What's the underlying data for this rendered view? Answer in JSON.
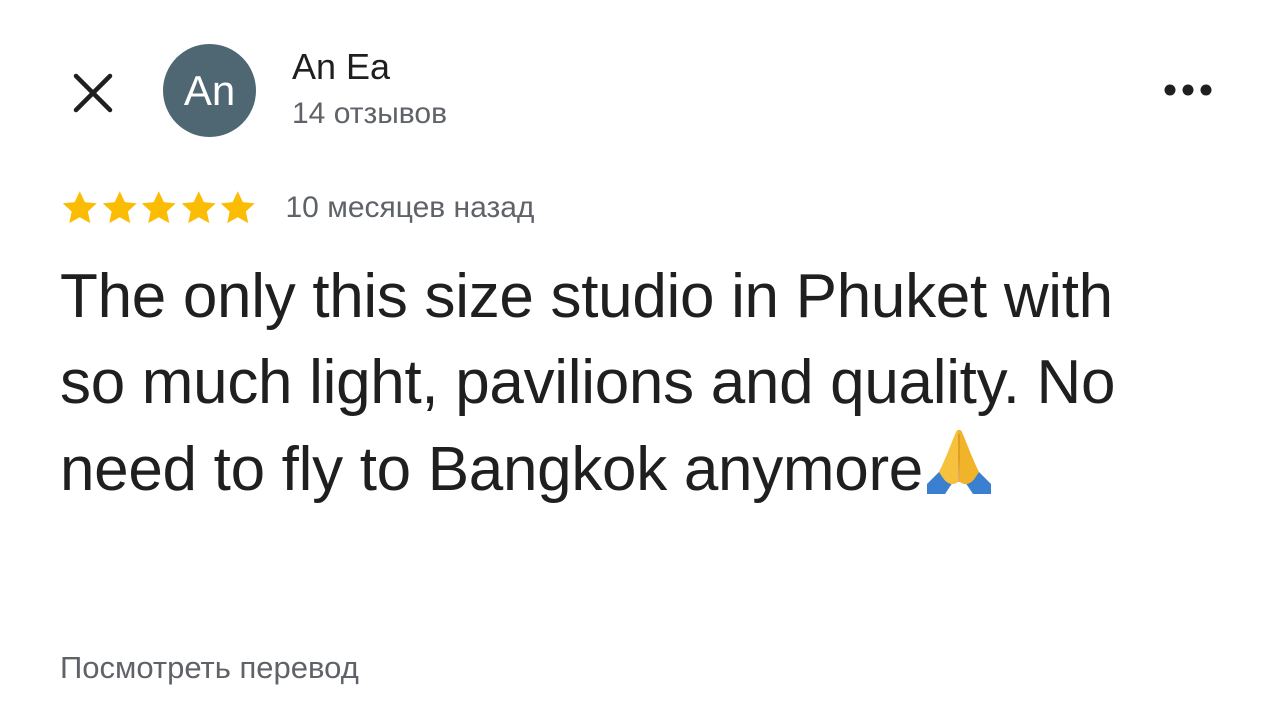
{
  "header": {
    "close_icon": "close-icon",
    "avatar_initials": "An",
    "avatar_color": "#4f6773",
    "author_name": "An Ea",
    "review_count": "14 отзывов",
    "more_icon": "more-horizontal-icon"
  },
  "review": {
    "rating": 5,
    "rating_max": 5,
    "star_color": "#fbbc04",
    "timestamp": "10 месяцев назад",
    "text": "The only this size studio in Phuket with so much light, pavilions and quality. No need to fly to Bangkok anymore",
    "emoji_icon": "folded-hands-emoji-icon"
  },
  "footer": {
    "translate_label": "Посмотреть перевод"
  }
}
